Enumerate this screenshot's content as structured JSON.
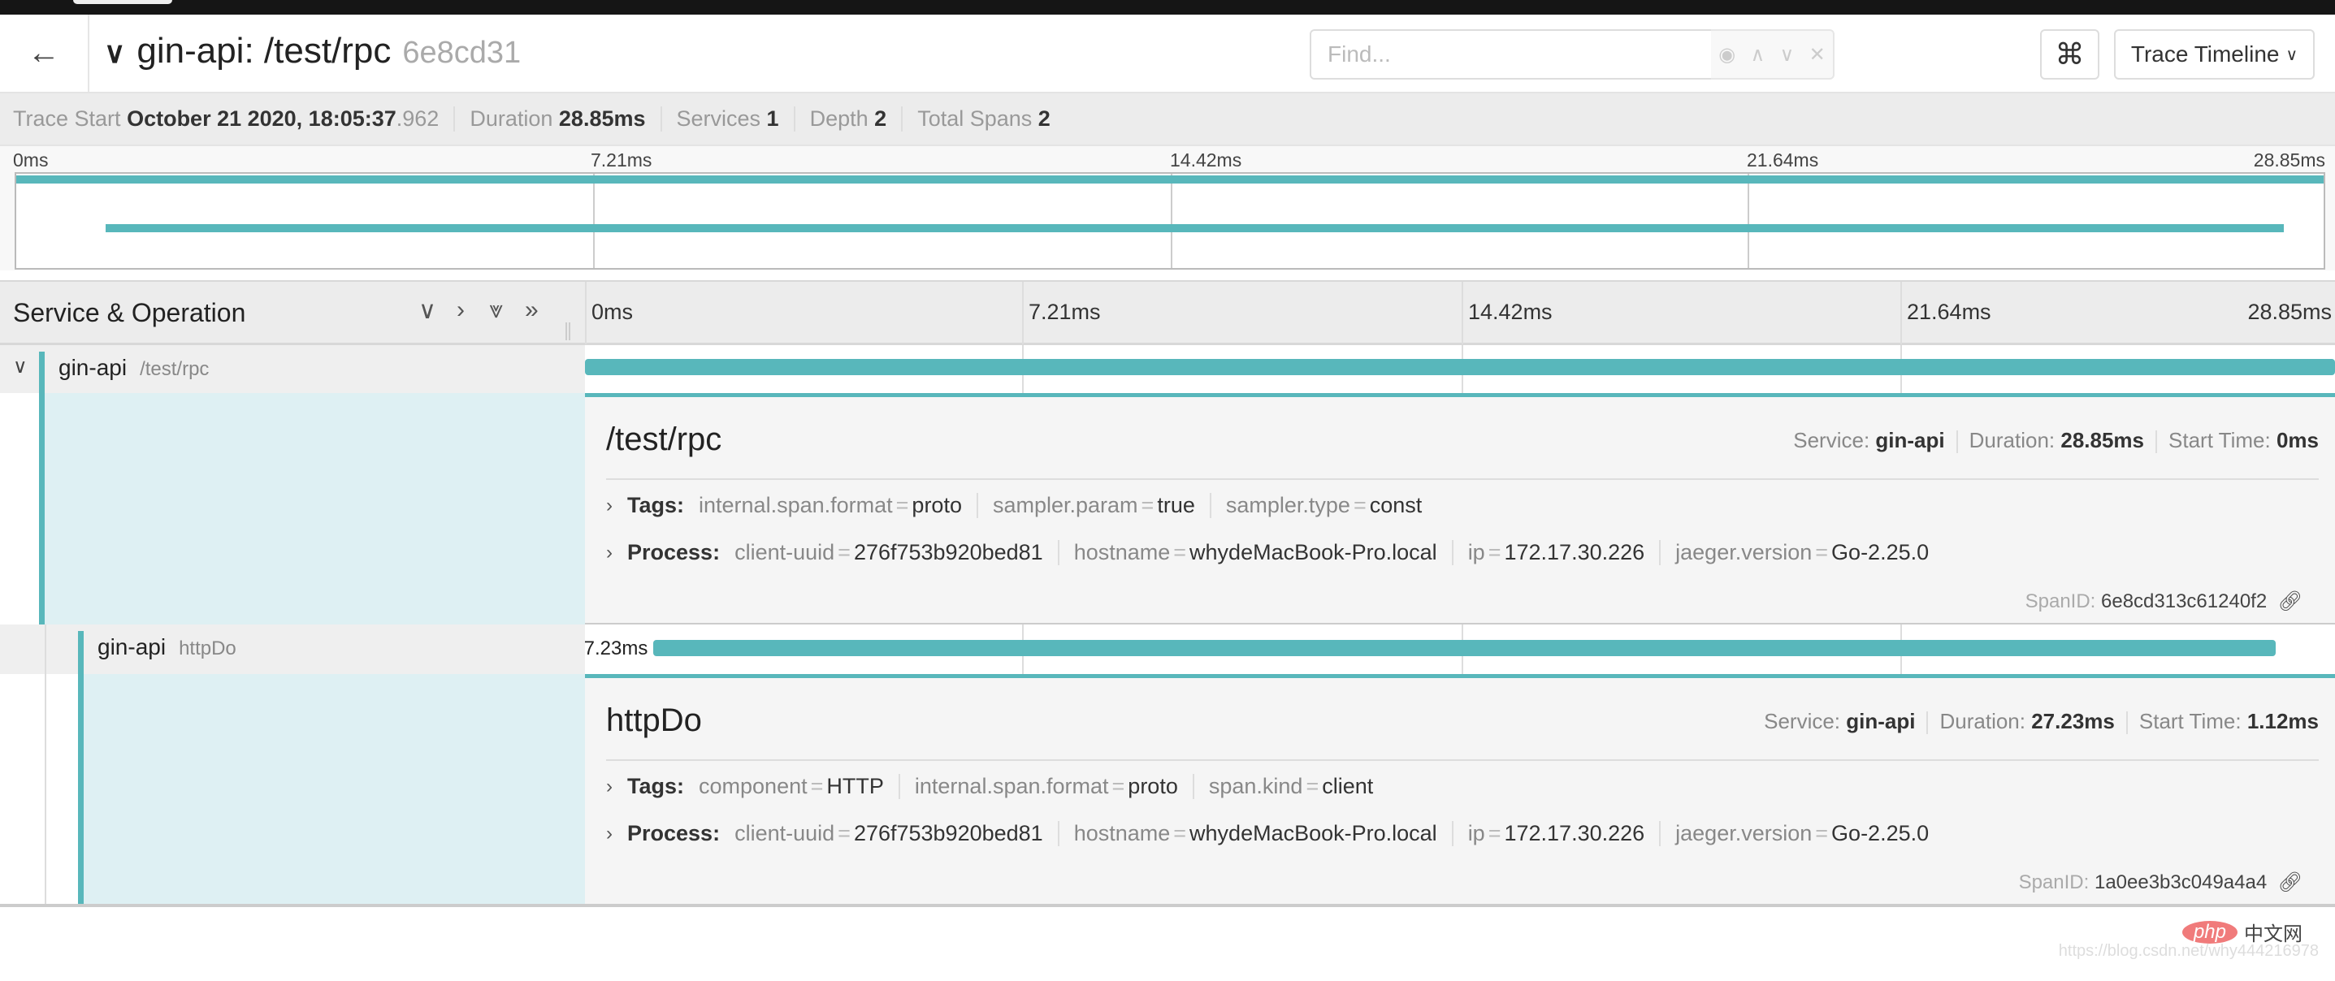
{
  "header": {
    "back_icon": "arrow-left-icon",
    "title": "gin-api: /test/rpc",
    "trace_id": "6e8cd31",
    "find_placeholder": "Find...",
    "view_select": "Trace Timeline",
    "kbd_icon": "command-icon"
  },
  "info": {
    "trace_start_label": "Trace Start",
    "trace_start": "October 21 2020, 18:05:37",
    "trace_start_ms": ".962",
    "duration_label": "Duration",
    "duration": "28.85ms",
    "services_label": "Services",
    "services": "1",
    "depth_label": "Depth",
    "depth": "2",
    "spans_label": "Total Spans",
    "spans": "2"
  },
  "ticks": [
    "0ms",
    "7.21ms",
    "14.42ms",
    "21.64ms",
    "28.85ms"
  ],
  "timeline": {
    "header_label": "Service & Operation",
    "total_ms": 28.85
  },
  "accent_color": "#58b7bb",
  "spans": [
    {
      "service": "gin-api",
      "operation": "/test/rpc",
      "start_ms": 0,
      "duration_ms": 28.85,
      "detail": {
        "title": "/test/rpc",
        "service_label": "Service:",
        "service": "gin-api",
        "duration_label": "Duration:",
        "duration": "28.85ms",
        "start_label": "Start Time:",
        "start": "0ms",
        "tags_label": "Tags:",
        "tags": [
          {
            "k": "internal.span.format",
            "v": "proto"
          },
          {
            "k": "sampler.param",
            "v": "true"
          },
          {
            "k": "sampler.type",
            "v": "const"
          }
        ],
        "process_label": "Process:",
        "process": [
          {
            "k": "client-uuid",
            "v": "276f753b920bed81"
          },
          {
            "k": "hostname",
            "v": "whydeMacBook-Pro.local"
          },
          {
            "k": "ip",
            "v": "172.17.30.226"
          },
          {
            "k": "jaeger.version",
            "v": "Go-2.25.0"
          }
        ],
        "spanid_label": "SpanID:",
        "spanid": "6e8cd313c61240f2"
      }
    },
    {
      "service": "gin-api",
      "operation": "httpDo",
      "start_ms": 1.12,
      "duration_ms": 27.23,
      "bar_label": "7.23ms",
      "detail": {
        "title": "httpDo",
        "service_label": "Service:",
        "service": "gin-api",
        "duration_label": "Duration:",
        "duration": "27.23ms",
        "start_label": "Start Time:",
        "start": "1.12ms",
        "tags_label": "Tags:",
        "tags": [
          {
            "k": "component",
            "v": "HTTP"
          },
          {
            "k": "internal.span.format",
            "v": "proto"
          },
          {
            "k": "span.kind",
            "v": "client"
          }
        ],
        "process_label": "Process:",
        "process": [
          {
            "k": "client-uuid",
            "v": "276f753b920bed81"
          },
          {
            "k": "hostname",
            "v": "whydeMacBook-Pro.local"
          },
          {
            "k": "ip",
            "v": "172.17.30.226"
          },
          {
            "k": "jaeger.version",
            "v": "Go-2.25.0"
          }
        ],
        "spanid_label": "SpanID:",
        "spanid": "1a0ee3b3c049a4a4"
      }
    }
  ],
  "watermark": {
    "logo": "php",
    "logo_text": "中文网",
    "url": "https://blog.csdn.net/why444216978"
  }
}
